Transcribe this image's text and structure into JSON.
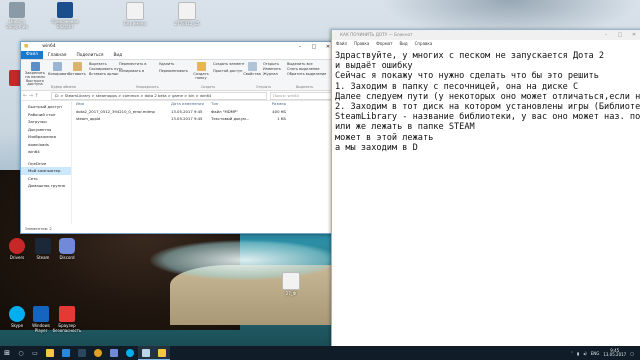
{
  "desktop": {
    "icons": [
      {
        "label": "Никита\nЗагрузчик",
        "color": "#8a9aa6"
      },
      {
        "label": "Приложение\nBlizzard",
        "color": "#1a4e8c"
      },
      {
        "label": "Без имени",
        "color": "#f2f2f2"
      },
      {
        "label": "2778415_25",
        "color": "#f2f2f2"
      },
      {
        "label": "Drivers",
        "color": "#c62828"
      },
      {
        "label": "Skype",
        "color": "#00aff0"
      },
      {
        "label": "Discord",
        "color": "#7289da"
      },
      {
        "label": "Steam",
        "color": "#1b2838"
      },
      {
        "label": "Windows\nPlayer",
        "color": "#1565c0"
      },
      {
        "label": "Браузер\nбезопасность",
        "color": "#e53935"
      },
      {
        "label": "Корзина",
        "color": "#cfd8dc"
      }
    ]
  },
  "explorer": {
    "title": "win64",
    "tabs": [
      "Файл",
      "Главная",
      "Поделиться",
      "Вид"
    ],
    "ribbon": {
      "pin_label": "Закрепить на панели быстрого доступа",
      "copy_label": "Копировать",
      "paste_label": "Вставить",
      "cut_label": "Вырезать",
      "copy_path_label": "Скопировать путь",
      "paste_shortcut_label": "Вставить ярлык",
      "move_label": "Переместить в",
      "copy_to_label": "Копировать в",
      "delete_label": "Удалить",
      "rename_label": "Переименовать",
      "new_folder_label": "Создать папку",
      "new_item_label": "Создать элемент",
      "easy_access_label": "Простой доступ",
      "properties_label": "Свойства",
      "open_label": "Открыть",
      "edit_label": "Изменить",
      "history_label": "Журнал",
      "select_all_label": "Выделить все",
      "select_none_label": "Снять выделение",
      "invert_label": "Обратить выделение",
      "groups": [
        "Буфер обмена",
        "Упорядочить",
        "Создать",
        "Открыть",
        "Выделить"
      ]
    },
    "address": {
      "path": "D: > SteamLibrary > steamapps > common > dota 2 beta > game > bin > win64",
      "search_placeholder": "Поиск: win64"
    },
    "nav": {
      "quick_access": "Быстрый доступ",
      "items": [
        "Рабочий стол",
        "Загрузки",
        "Документы",
        "Изображения",
        "downloads",
        "win64"
      ],
      "onedrive": "OneDrive",
      "this_pc": "Мой компьютер",
      "network": "Сеть",
      "homegroup": "Домашняя группа"
    },
    "columns": {
      "name": "Имя",
      "date": "Дата изменения",
      "type": "Тип",
      "size": "Размер"
    },
    "rows": [
      {
        "name": "dota2_2017_0512_394210_0_error.mdmp",
        "date": "13.05.2017 9:45",
        "type": "Файл \"MDMP\"",
        "size": "400 КБ"
      },
      {
        "name": "steam_appid",
        "date": "13.05.2017 9:45",
        "type": "Текстовый докум...",
        "size": "1 КБ"
      }
    ],
    "status": "Элементов: 2"
  },
  "notepad": {
    "title": "КАК ПОЧИНИТЬ ДОТУ — Блокнот",
    "menu": [
      "Файл",
      "Правка",
      "Формат",
      "Вид",
      "Справка"
    ],
    "lines": [
      "Здраствуйте, у многих с песком не запускается Дота 2",
      "и выдаёт ошибку",
      "Сейчас я покажу что нужно сделать что бы это решить",
      "1. Заходим в папку с песочницей, она на диске С",
      "Далее следуем пути (у некоторых оно может отличаться,если не у",
      "2. Заходим в тот диск на котором установлены игры (Библиотека",
      "SteamLibrary - название библиотеки, у вас оно может наз. по дру",
      "или же лежать в папке STEAM",
      "может в этой лежать",
      "а мы заходим в D"
    ]
  },
  "desktop_file": {
    "label": "27_Ф"
  },
  "taskbar": {
    "apps": [
      {
        "name": "Explorer",
        "color": "#f6c744"
      },
      {
        "name": "Edge",
        "color": "#2b88d8"
      },
      {
        "name": "Steam",
        "color": "#2a475e"
      },
      {
        "name": "Chrome",
        "color": "#e0a020"
      },
      {
        "name": "Discord",
        "color": "#7289da"
      },
      {
        "name": "Skype",
        "color": "#00aff0"
      },
      {
        "name": "Notepad",
        "color": "#b9d7ea"
      },
      {
        "name": "Explorer window",
        "color": "#f6c744"
      }
    ],
    "lang": "ENG",
    "time": "9:45",
    "date": "13.05.2017"
  }
}
